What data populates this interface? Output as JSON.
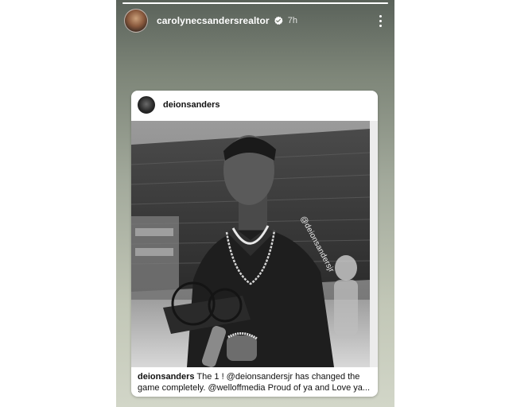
{
  "story": {
    "progress": 1.0,
    "username": "carolynecsandersrealtor",
    "verified_icon": "verified-check-icon",
    "time": "7h",
    "more_icon": "more-vertical-icon"
  },
  "post": {
    "username": "deionsanders",
    "photo_watermark": "@deionsandersjr",
    "caption_user": "deionsanders",
    "caption_line1": " The 1 ! @deionsandersjr has changed the",
    "caption_line2": "game completely. @welloffmedia Proud of ya and Love ya..."
  },
  "colors": {
    "story_background": "#a3aa9c",
    "card_background": "#ffffff",
    "text": "#111111"
  }
}
